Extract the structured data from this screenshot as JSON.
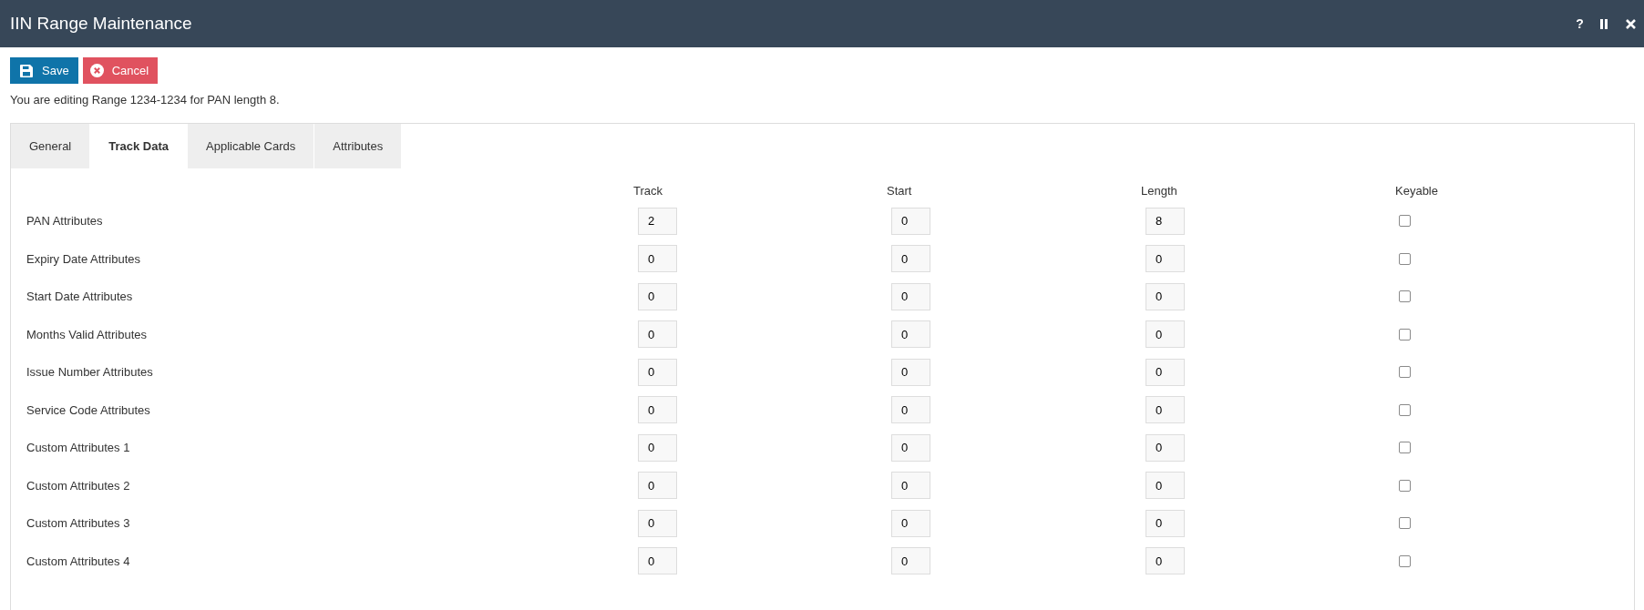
{
  "window": {
    "title": "IIN Range Maintenance",
    "controls": [
      {
        "kind": "help",
        "label": "?"
      },
      {
        "kind": "pause"
      },
      {
        "kind": "close"
      }
    ]
  },
  "toolbar": [
    {
      "kind": "save",
      "label": "Save"
    },
    {
      "kind": "cancel",
      "label": "Cancel"
    }
  ],
  "message": "You are editing Range 1234-1234 for PAN length 8.",
  "tabs": [
    {
      "label": "General",
      "selected": false
    },
    {
      "label": "Track Data",
      "selected": true
    },
    {
      "label": "Applicable Cards",
      "selected": false
    },
    {
      "label": "Attributes",
      "selected": false
    }
  ],
  "table": {
    "columns": [
      "Track",
      "Start",
      "Length",
      "Keyable"
    ],
    "rows": [
      {
        "label": "PAN Attributes",
        "track": "2",
        "start": "0",
        "length": "8",
        "keyable": false
      },
      {
        "label": "Expiry Date Attributes",
        "track": "0",
        "start": "0",
        "length": "0",
        "keyable": false
      },
      {
        "label": "Start Date Attributes",
        "track": "0",
        "start": "0",
        "length": "0",
        "keyable": false
      },
      {
        "label": "Months Valid Attributes",
        "track": "0",
        "start": "0",
        "length": "0",
        "keyable": false
      },
      {
        "label": "Issue Number Attributes",
        "track": "0",
        "start": "0",
        "length": "0",
        "keyable": false
      },
      {
        "label": "Service Code Attributes",
        "track": "0",
        "start": "0",
        "length": "0",
        "keyable": false
      },
      {
        "label": "Custom Attributes 1",
        "track": "0",
        "start": "0",
        "length": "0",
        "keyable": false
      },
      {
        "label": "Custom Attributes 2",
        "track": "0",
        "start": "0",
        "length": "0",
        "keyable": false
      },
      {
        "label": "Custom Attributes 3",
        "track": "0",
        "start": "0",
        "length": "0",
        "keyable": false
      },
      {
        "label": "Custom Attributes 4",
        "track": "0",
        "start": "0",
        "length": "0",
        "keyable": false
      }
    ]
  }
}
